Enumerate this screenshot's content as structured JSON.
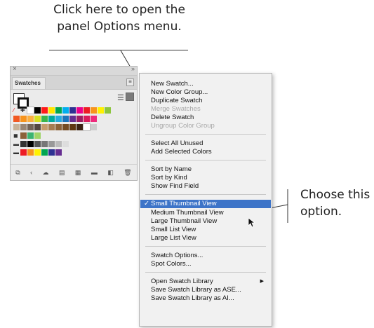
{
  "callouts": {
    "top_line1": "Click here to open the",
    "top_line2": "panel Options menu.",
    "right_line1": "Choose this",
    "right_line2": "option."
  },
  "panel": {
    "tab_label": "Swatches",
    "close_icon": "close-icon",
    "menu_icon": "panel-menu-icon"
  },
  "swatch_colors": {
    "row1": [
      "#ffffff",
      "#000000",
      "#ff1a1a",
      "#ffe600",
      "#00a651",
      "#00aeef",
      "#2e3192",
      "#ec008c",
      "#ed1c24",
      "#f7941d",
      "#fff200",
      "#8dc63f"
    ],
    "row2": [
      "#f15a24",
      "#f7941d",
      "#fbb040",
      "#d7df23",
      "#39b54a",
      "#00a99d",
      "#27aae1",
      "#1c75bc",
      "#662d91",
      "#9e1f63",
      "#da1c5c",
      "#ee2a7b"
    ],
    "row3": [
      "#c7b299",
      "#998675",
      "#736357",
      "#534741",
      "#c69c6d",
      "#a67c52",
      "#8c6239",
      "#754c24",
      "#603813",
      "#3c2415",
      "#ffffff",
      "#cccccc"
    ],
    "row4": [
      "#333333",
      "#000000",
      "#555555",
      "#777777",
      "#999999",
      "#bbbbbb",
      "#dddddd"
    ],
    "row5": [
      "#ed1c24",
      "#f7941d",
      "#fff200",
      "#00a651",
      "#2e3192",
      "#662d91"
    ],
    "row_pattern": [
      "#8c6239",
      "#3cb371",
      "#a0d468"
    ]
  },
  "menu": {
    "items": [
      "New Swatch...",
      "New Color Group...",
      "Duplicate Swatch",
      "Merge Swatches",
      "Delete Swatch",
      "Ungroup Color Group",
      "Select All Unused",
      "Add Selected Colors",
      "Sort by Name",
      "Sort by Kind",
      "Show Find Field",
      "Small Thumbnail View",
      "Medium Thumbnail View",
      "Large Thumbnail View",
      "Small List View",
      "Large List View",
      "Swatch Options...",
      "Spot Colors...",
      "Open Swatch Library",
      "Save Swatch Library as ASE...",
      "Save Swatch Library as AI..."
    ],
    "checkmark": "✓",
    "submenu_arrow": "▶"
  },
  "colors": {
    "highlight": "#3d74c8",
    "disabled_text": "#a8a8a8"
  }
}
